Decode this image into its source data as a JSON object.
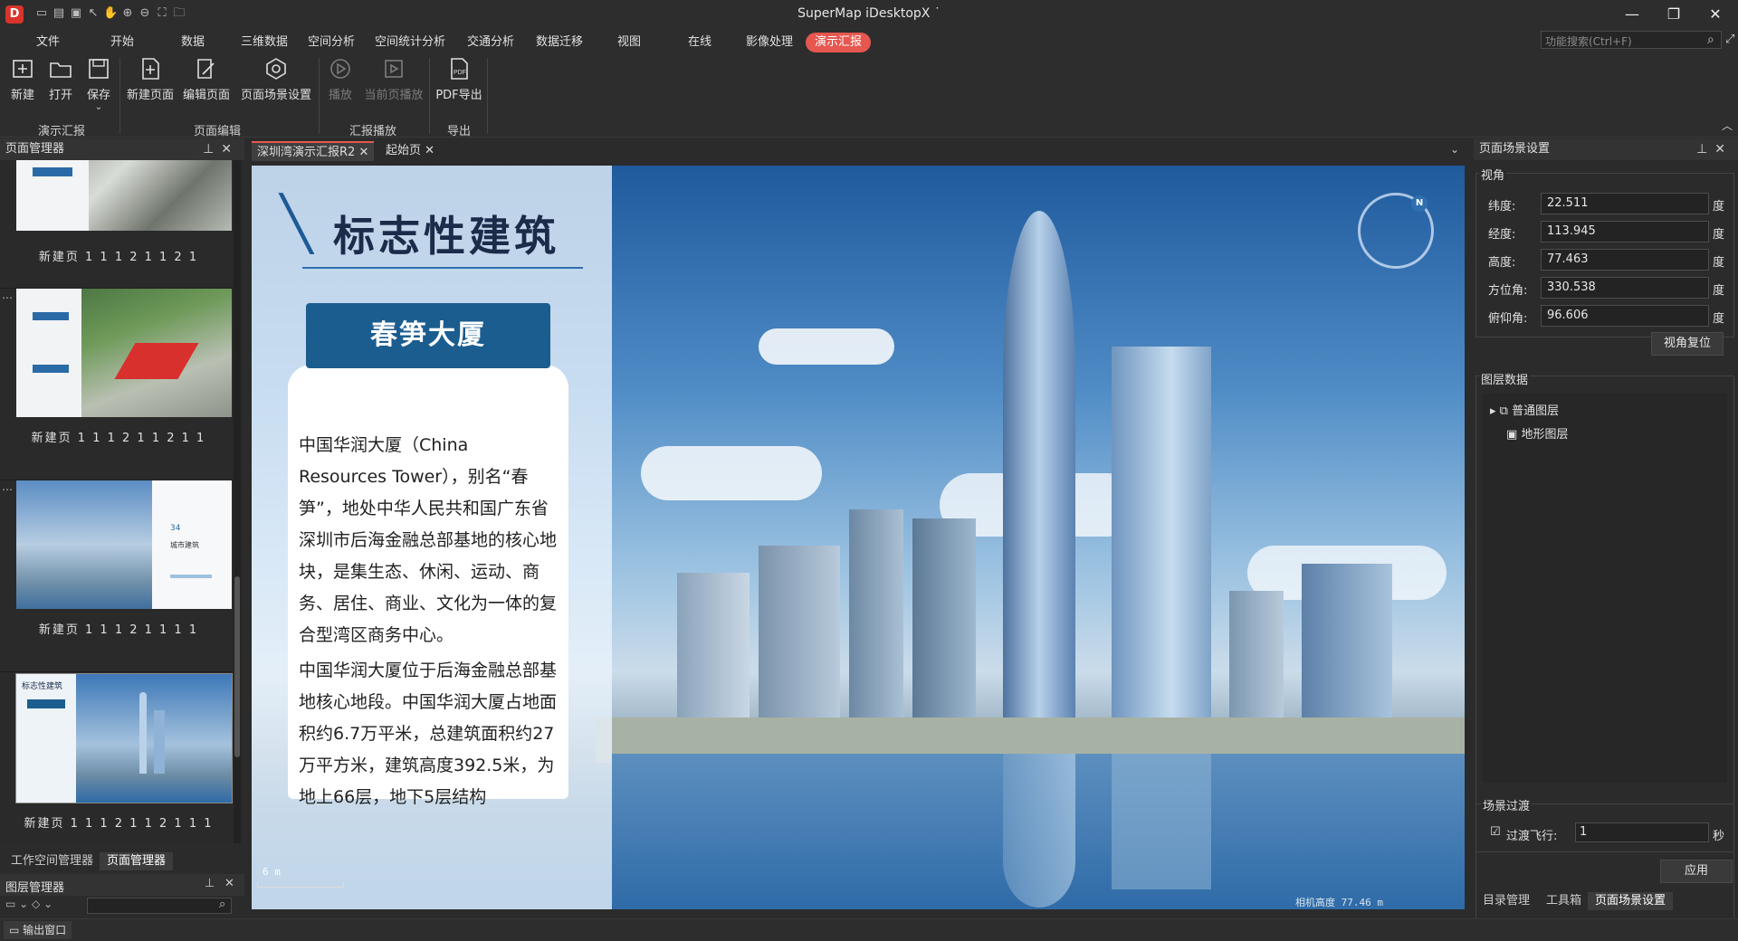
{
  "app": {
    "title": "SuperMap iDesktopX ˙",
    "logo_letter": "D"
  },
  "menu": {
    "tabs": [
      "文件",
      "开始",
      "数据",
      "三维数据",
      "空间分析",
      "空间统计分析",
      "交通分析",
      "数据迁移",
      "视图",
      "在线",
      "影像处理",
      "演示汇报"
    ],
    "active_index": 11,
    "search_placeholder": "功能搜索(Ctrl+F)"
  },
  "ribbon": {
    "buttons": [
      {
        "label": "新建",
        "icon": "new-icon"
      },
      {
        "label": "打开",
        "icon": "open-folder-icon"
      },
      {
        "label": "保存",
        "icon": "save-icon"
      },
      {
        "label": "新建页面",
        "icon": "new-page-icon"
      },
      {
        "label": "编辑页面",
        "icon": "edit-page-icon"
      },
      {
        "label": "页面场景设置",
        "icon": "scene-settings-icon"
      },
      {
        "label": "播放",
        "icon": "play-icon"
      },
      {
        "label": "当前页播放",
        "icon": "play-current-icon"
      },
      {
        "label": "PDF导出",
        "icon": "pdf-icon"
      }
    ],
    "groups": [
      "演示汇报",
      "页面编辑",
      "汇报播放",
      "导出"
    ]
  },
  "page_manager": {
    "title": "页面管理器",
    "pages": [
      {
        "label": "新建页 1 1 1 2 1 1 2 1"
      },
      {
        "label": "新建页 1 1 1 2 1 1 2 1 1"
      },
      {
        "label": "新建页 1 1 1 2 1 1 1 1"
      },
      {
        "label": "新建页 1 1 1 2 1 1 2 1 1 1"
      }
    ],
    "selected_index": 3,
    "thumb3_mini_text": {
      "number": "34",
      "title": "城市建筑"
    },
    "thumb4_mini_title": "标志性建筑",
    "bottom_tabs": [
      "工作空间管理器",
      "页面管理器"
    ],
    "bottom_active": 1
  },
  "layer_manager": {
    "title": "图层管理器"
  },
  "output_window": "输出窗口",
  "doc_tabs": [
    {
      "label": "深圳湾演示汇报R2",
      "active": true
    },
    {
      "label": "起始页",
      "active": false
    }
  ],
  "slide": {
    "title": "标志性建筑",
    "subtitle": "春笋大厦",
    "para1": "中国华润大厦（China Resources Tower），别名“春笋”，地处中华人民共和国广东省深圳市后海金融总部基地的核心地块，是集生态、休闲、运动、商务、居住、商业、文化为一体的复合型湾区商务中心。",
    "para2": "中国华润大厦位于后海金融总部基地核心地段。中国华润大厦占地面积约6.7万平米，总建筑面积约27万平方米，建筑高度392.5米，为地上66层，地下5层结构",
    "scale_label": "6 m",
    "camera_height": "相机高度 77.46 m",
    "compass_n": "N"
  },
  "scene_settings": {
    "panel_title": "页面场景设置",
    "view_group": "视角",
    "fields": [
      {
        "label": "纬度:",
        "value": "22.511",
        "unit": "度"
      },
      {
        "label": "经度:",
        "value": "113.945",
        "unit": "度"
      },
      {
        "label": "高度:",
        "value": "77.463",
        "unit": "度"
      },
      {
        "label": "方位角:",
        "value": "330.538",
        "unit": "度"
      },
      {
        "label": "俯仰角:",
        "value": "96.606",
        "unit": "度"
      }
    ],
    "reset_view": "视角复位",
    "layer_group": "图层数据",
    "layers": [
      "普通图层",
      "地形图层"
    ],
    "transition_group": "场景过渡",
    "transition_label": "过渡飞行:",
    "transition_value": "1",
    "transition_unit": "秒",
    "apply": "应用",
    "bottom_tabs": [
      "目录管理",
      "工具箱",
      "页面场景设置"
    ],
    "bottom_active": 2
  }
}
